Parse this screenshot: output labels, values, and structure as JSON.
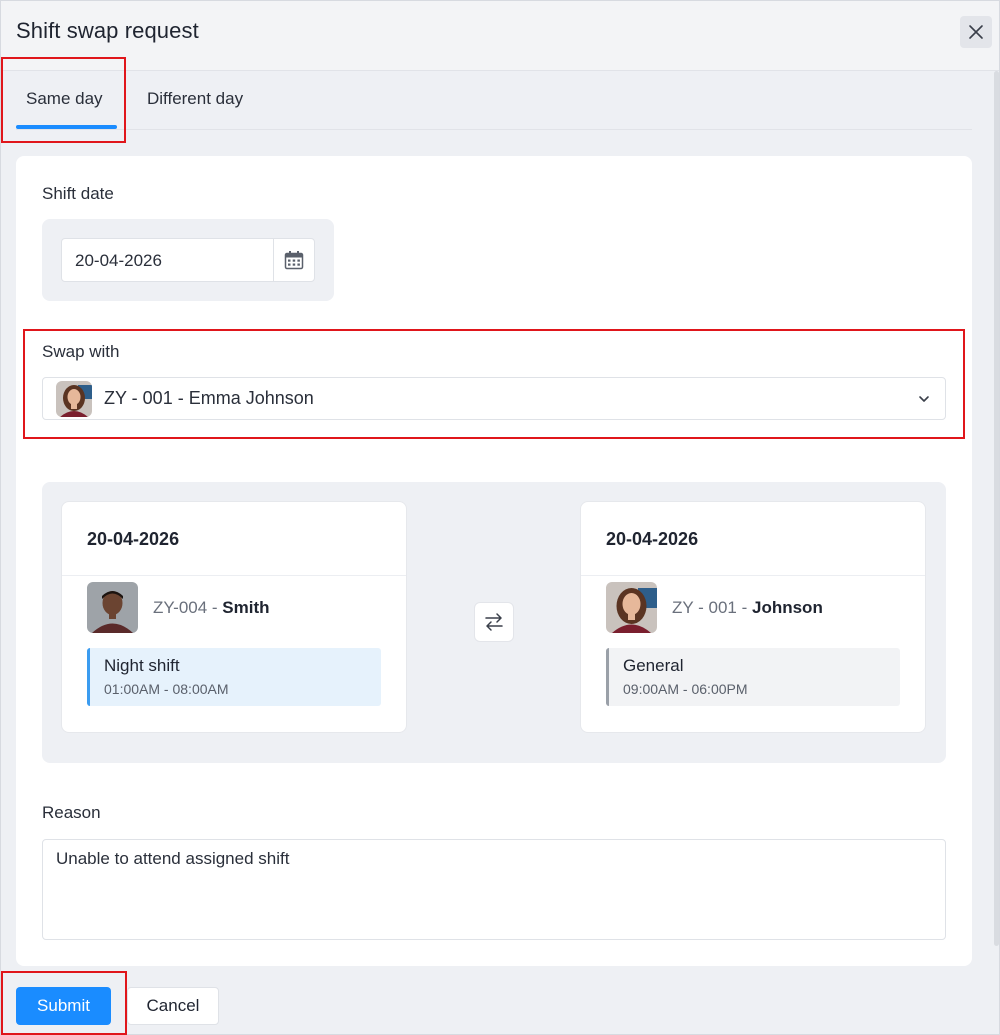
{
  "dialog": {
    "title": "Shift swap request",
    "close_icon": "close-icon"
  },
  "tabs": [
    {
      "label": "Same day",
      "active": true
    },
    {
      "label": "Different day",
      "active": false
    }
  ],
  "form": {
    "shift_date_label": "Shift date",
    "shift_date_value": "20-04-2026",
    "calendar_icon": "calendar-icon",
    "swap_with_label": "Swap with",
    "swap_with_value": "ZY - 001 - Emma Johnson",
    "dropdown_icon": "chevron-down-icon",
    "reason_label": "Reason",
    "reason_value": "Unable to attend assigned shift"
  },
  "swap": {
    "left": {
      "date": "20-04-2026",
      "employee_id": "ZY-004 - ",
      "employee_name": "Smith",
      "shift_name": "Night shift",
      "shift_time": "01:00AM - 08:00AM"
    },
    "right": {
      "date": "20-04-2026",
      "employee_id": "ZY - 001 - ",
      "employee_name": "Johnson",
      "shift_name": "General",
      "shift_time": "09:00AM - 06:00PM"
    },
    "swap_icon": "swap-arrows-icon"
  },
  "footer": {
    "submit_label": "Submit",
    "cancel_label": "Cancel"
  },
  "colors": {
    "accent": "#1a8cff",
    "highlight": "#e0161b",
    "night_shift_bg": "#e6f2fc",
    "general_shift_bg": "#f2f3f5"
  }
}
